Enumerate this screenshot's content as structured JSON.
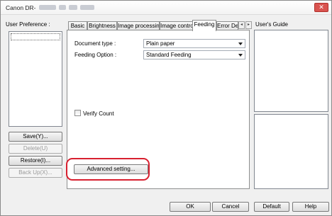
{
  "window": {
    "title": "Canon DR-",
    "close_label": "✕"
  },
  "left_panel": {
    "user_preference_label": "User Preference :",
    "save_label": "Save(Y)...",
    "delete_label": "Delete(U)",
    "restore_label": "Restore(I)...",
    "backup_label": "Back Up(X)..."
  },
  "tabs": [
    {
      "label": "Basic"
    },
    {
      "label": "Brightness"
    },
    {
      "label": "Image processing"
    },
    {
      "label": "Image control"
    },
    {
      "label": "Feeding"
    },
    {
      "label": "Error De"
    }
  ],
  "active_tab": "Feeding",
  "feeding": {
    "document_type_label": "Document type :",
    "document_type_value": "Plain paper",
    "feeding_option_label": "Feeding Option :",
    "feeding_option_value": "Standard Feeding",
    "verify_count_label": "Verify Count",
    "verify_count_checked": false,
    "advanced_setting_label": "Advanced setting..."
  },
  "right_panel": {
    "users_guide_label": "User's Guide"
  },
  "footer": {
    "ok_label": "OK",
    "cancel_label": "Cancel",
    "default_label": "Default",
    "help_label": "Help"
  }
}
